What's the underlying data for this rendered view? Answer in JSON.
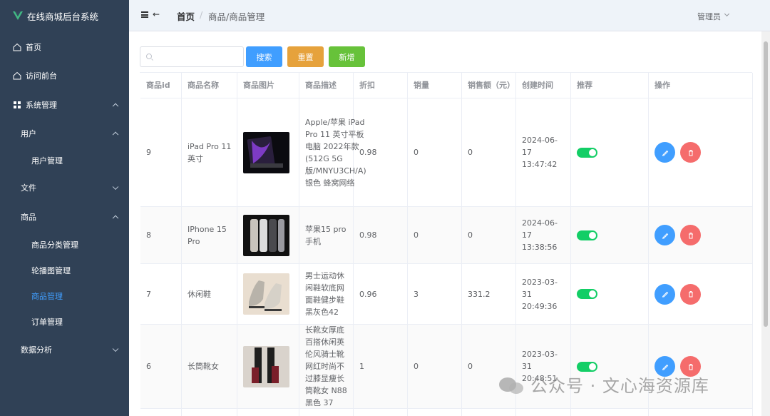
{
  "app": {
    "title": "在线商城后台系统"
  },
  "sidebar": {
    "items": [
      {
        "label": "首页",
        "icon": "home-icon"
      },
      {
        "label": "访问前台",
        "icon": "home-icon"
      },
      {
        "label": "系统管理",
        "icon": "grid-icon"
      },
      {
        "label": "用户"
      },
      {
        "label": "用户管理"
      },
      {
        "label": "文件"
      },
      {
        "label": "商品"
      },
      {
        "label": "商品分类管理"
      },
      {
        "label": "轮播图管理"
      },
      {
        "label": "商品管理"
      },
      {
        "label": "订单管理"
      },
      {
        "label": "数据分析"
      }
    ]
  },
  "header": {
    "home": "首页",
    "separator": "/",
    "current": "商品/商品管理",
    "user": "管理员"
  },
  "toolbar": {
    "search_placeholder": "",
    "search_label": "搜索",
    "reset_label": "重置",
    "add_label": "新增"
  },
  "table": {
    "columns": [
      "商品id",
      "商品名称",
      "商品图片",
      "商品描述",
      "折扣",
      "销量",
      "销售额（元）",
      "创建时间",
      "推荐",
      "操作"
    ],
    "rows": [
      {
        "id": "9",
        "name": "iPad Pro 11 英寸",
        "desc": "Apple/苹果 iPad Pro 11 英寸平板电脑 2022年款(512G 5G版/MNYU3CH/A) 银色 蜂窝网络",
        "discount": "0.98",
        "sales": "0",
        "revenue": "0",
        "created": "2024-06-17 13:47:42",
        "recommend": true
      },
      {
        "id": "8",
        "name": "IPhone 15 Pro",
        "desc": "苹果15 pro 手机",
        "discount": "0.98",
        "sales": "0",
        "revenue": "0",
        "created": "2024-06-17 13:38:56",
        "recommend": true
      },
      {
        "id": "7",
        "name": "休闲鞋",
        "desc": "男士运动休闲鞋软底网面鞋健步鞋黑灰色42",
        "discount": "0.96",
        "sales": "3",
        "revenue": "331.2",
        "created": "2023-03-31 20:49:36",
        "recommend": true
      },
      {
        "id": "6",
        "name": "长筒靴女",
        "desc": "长靴女厚底百搭休闲英伦风骑士靴网红时尚不过膝显瘦长筒靴女 N88 黑色 37",
        "discount": "1",
        "sales": "0",
        "revenue": "0",
        "created": "2023-03-31 20:48:51",
        "recommend": true
      }
    ]
  },
  "watermark": "公众号 · 文心海资源库",
  "colors": {
    "sidebar": "#304156",
    "primary": "#409eff",
    "warning": "#e6a23c",
    "success": "#67c23a",
    "danger": "#f56c6c",
    "switch_on": "#13ce66"
  }
}
